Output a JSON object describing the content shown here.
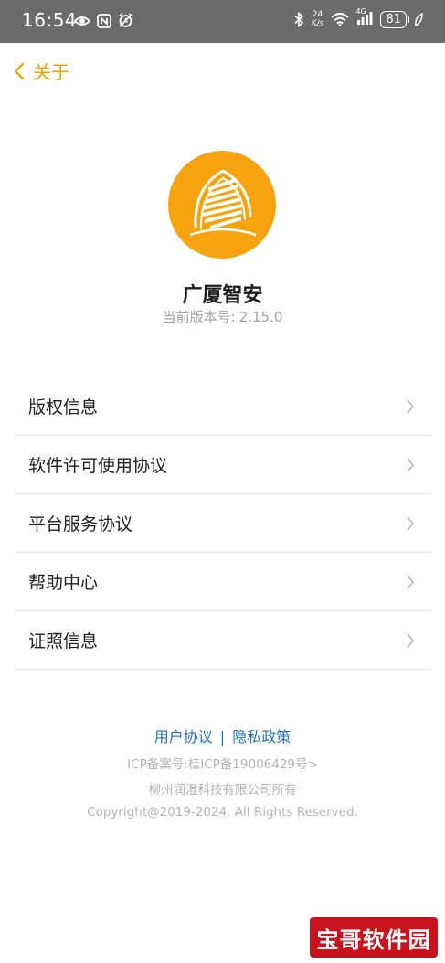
{
  "status_bar": {
    "time": "16:54",
    "net_speed_value": "24",
    "net_speed_unit": "K/s",
    "network": "4G",
    "battery": "81",
    "icons": [
      "eye-icon",
      "nfc-icon",
      "alarm-icon",
      "bluetooth-icon",
      "wifi-icon",
      "signal-icon",
      "leaf-icon"
    ]
  },
  "nav": {
    "back_label": "关于"
  },
  "app": {
    "name": "广厦智安",
    "version_label": "当前版本号:",
    "version": "2.15.0",
    "logo_color": "#f5a30f"
  },
  "menu": {
    "items": [
      {
        "label": "版权信息"
      },
      {
        "label": "软件许可使用协议"
      },
      {
        "label": "平台服务协议"
      },
      {
        "label": "帮助中心"
      },
      {
        "label": "证照信息"
      }
    ]
  },
  "footer": {
    "user_agreement": "用户协议",
    "separator": "|",
    "privacy_policy": "隐私政策",
    "icp": "ICP备案号:桂ICP备19006429号>",
    "company": "柳州润澄科技有限公司所有",
    "copyright": "Copyright@2019-2024. All Rights Reserved."
  },
  "watermark": {
    "text": "宝哥软件园"
  },
  "colors": {
    "accent": "#f0a400",
    "link": "#1f73c2",
    "status_bar": "#6b6b6b"
  }
}
